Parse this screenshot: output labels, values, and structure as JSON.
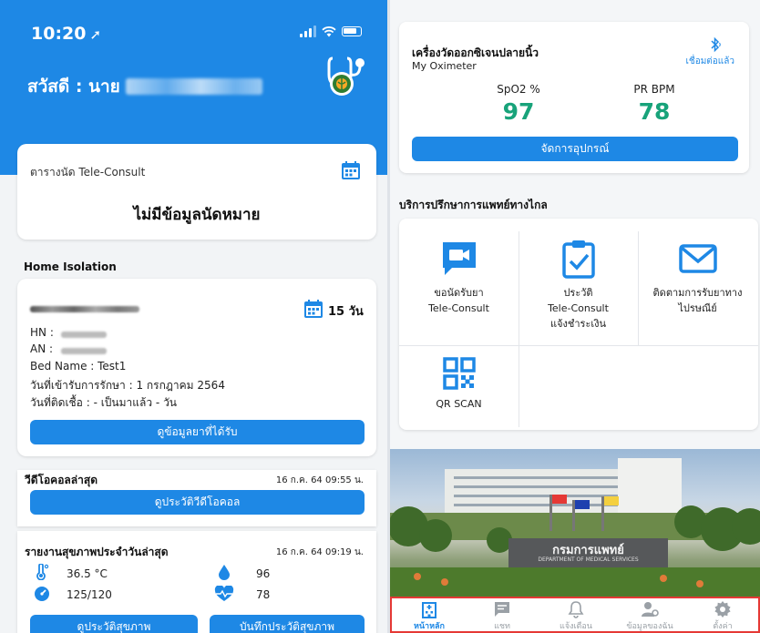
{
  "status": {
    "time": "10:20",
    "arrow": "➚"
  },
  "header": {
    "greeting": "สวัสดี : นาย"
  },
  "tele_consult": {
    "label": "ตารางนัด Tele-Consult",
    "empty_text": "ไม่มีข้อมูลนัดหมาย"
  },
  "home_isolation": {
    "section_title": "Home Isolation",
    "days": "15 วัน",
    "hn_label": "HN :",
    "an_label": "AN :",
    "bed_name": "Bed Name : Test1",
    "admit_date": "วันที่เข้ารับการรักษา : 1 กรกฎาคม 2564",
    "infected_date": "วันที่ติดเชื้อ : - เป็นมาแล้ว - วัน",
    "button": "ดูข้อมูลยาที่ได้รับ"
  },
  "video_call": {
    "title": "วีดีโอคอลล่าสุด",
    "date": "16 ก.ค. 64 09:55 น.",
    "button": "ดูประวัติวีดีโอคอล"
  },
  "health_report": {
    "title": "รายงานสุขภาพประจำวันล่าสุด",
    "date": "16 ก.ค. 64 09:19 น.",
    "temperature": "36.5 °C",
    "oxygen": "96",
    "blood_pressure": "125/120",
    "heart_rate": "78",
    "button_history": "ดูประวัติสุขภาพ",
    "button_record": "บันทึกประวัติสุขภาพ"
  },
  "oximeter": {
    "title": "เครื่องวัดออกซิเจนปลายนิ้ว",
    "subtitle": "My Oximeter",
    "connection": "เชื่อมต่อแล้ว",
    "spo2_label": "SpO2 %",
    "spo2_value": "97",
    "pr_label": "PR BPM",
    "pr_value": "78",
    "button": "จัดการอุปกรณ์"
  },
  "services": {
    "title": "บริการปรึกษาการแพทย์ทางไกล",
    "items": [
      {
        "line1": "ขอนัดรับยา",
        "line2": "Tele-Consult",
        "line3": ""
      },
      {
        "line1": "ประวัติ",
        "line2": "Tele-Consult",
        "line3": "แจ้งชำระเงิน"
      },
      {
        "line1": "ติดตามการรับยาทาง",
        "line2": "ไปรษณีย์",
        "line3": ""
      },
      {
        "line1": "QR SCAN",
        "line2": "",
        "line3": ""
      }
    ]
  },
  "banner": {
    "sign_th": "กรมการแพทย์",
    "sign_en": "DEPARTMENT OF MEDICAL SERVICES"
  },
  "tabbar": {
    "home": "หน้าหลัก",
    "chat": "แชท",
    "notifications": "แจ้งเตือน",
    "profile": "ข้อมูลของฉัน",
    "settings": "ตั้งค่า"
  },
  "colors": {
    "primary": "#1e88e5",
    "value_green": "#18a37a",
    "tab_highlight": "#e53935"
  }
}
